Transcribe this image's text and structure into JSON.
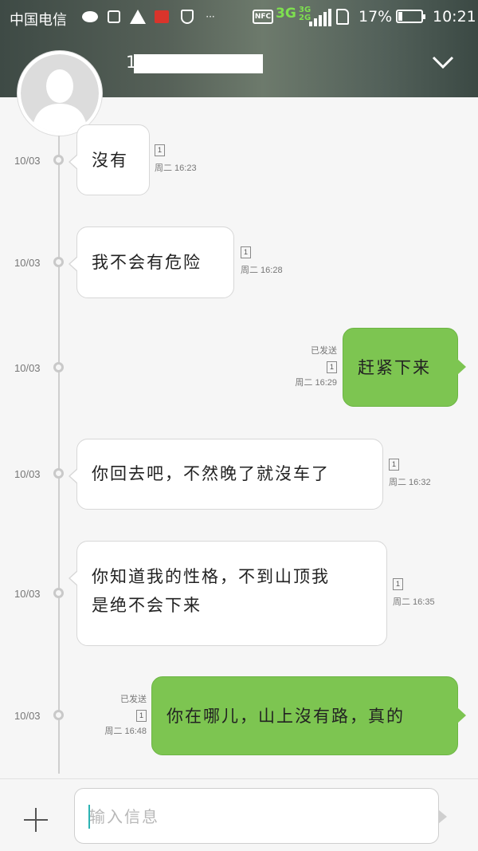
{
  "status_bar": {
    "carrier": "中国电信",
    "network_main": "3G",
    "network_sub_top": "3G",
    "network_sub_bottom": "2G",
    "nfc": "NFC",
    "more": "···",
    "battery_pct": "17%",
    "battery_level": 0.17,
    "time": "10:21"
  },
  "header": {
    "contact_name_visible": "1"
  },
  "messages": [
    {
      "direction": "in",
      "date": "10/03",
      "text": "沒有",
      "sim": "1",
      "time": "周二  16:23"
    },
    {
      "direction": "in",
      "date": "10/03",
      "text": "我不会有危险",
      "sim": "1",
      "time": "周二  16:28"
    },
    {
      "direction": "out",
      "date": "10/03",
      "text": "赶紧下来",
      "sim": "1",
      "time": "周二  16:29",
      "status": "已发送"
    },
    {
      "direction": "in",
      "date": "10/03",
      "text": "你回去吧，不然晚了就沒车了",
      "sim": "1",
      "time": "周二  16:32"
    },
    {
      "direction": "in",
      "date": "10/03",
      "text_line1": "你知道我的性格，不到山顶我",
      "text_line2": "是绝不会下来",
      "sim": "1",
      "time": "周二  16:35"
    },
    {
      "direction": "out",
      "date": "10/03",
      "text": "你在哪儿，山上沒有路，真的",
      "sim": "1",
      "time": "周二  16:48",
      "status": "已发送"
    }
  ],
  "composer": {
    "placeholder": "输入信息",
    "value": ""
  },
  "colors": {
    "outgoing_bubble": "#7dc551",
    "incoming_bubble": "#ffffff",
    "header_bg": "#566158"
  },
  "icons": [
    "wechat-icon",
    "lock-icon",
    "warning-icon",
    "huawei-icon",
    "shield-icon",
    "nfc-icon",
    "signal-icon",
    "sim-icon",
    "battery-icon",
    "chevron-down-icon",
    "avatar-placeholder-icon",
    "add-icon"
  ]
}
